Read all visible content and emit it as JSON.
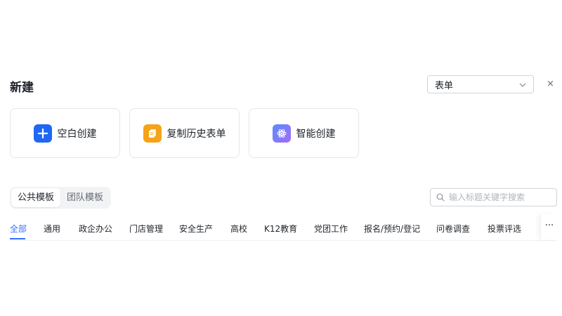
{
  "header": {
    "title": "新建",
    "close_label": "×"
  },
  "type_select": {
    "value": "表单"
  },
  "cards": [
    {
      "label": "空白创建",
      "icon": "plus-icon",
      "color": "#1f67f4"
    },
    {
      "label": "复制历史表单",
      "icon": "copy-icon",
      "color": "#f5a31a"
    },
    {
      "label": "智能创建",
      "icon": "ai-sparkle-icon",
      "color": "#7b6cf6"
    }
  ],
  "template_source": {
    "options": [
      "公共模板",
      "团队模板"
    ],
    "selected": "公共模板"
  },
  "search": {
    "placeholder": "输入标题关键字搜索"
  },
  "categories": {
    "items": [
      "全部",
      "通用",
      "政企办公",
      "门店管理",
      "安全生产",
      "高校",
      "K12教育",
      "党团工作",
      "报名/预约/登记",
      "问卷调查",
      "投票评选"
    ],
    "selected": "全部",
    "more_label": "···"
  }
}
